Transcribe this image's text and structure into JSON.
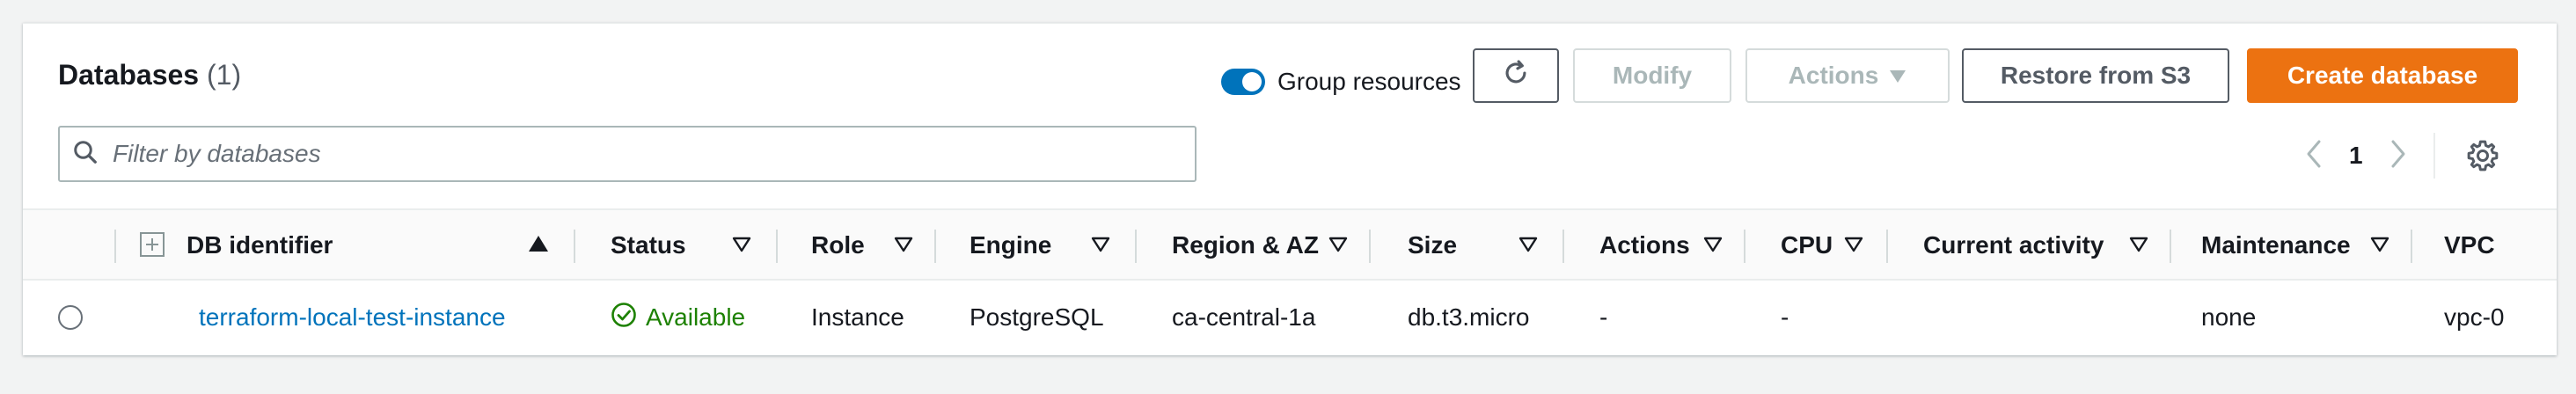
{
  "header": {
    "title": "Databases",
    "count": "(1)"
  },
  "toolbar": {
    "group_resources_label": "Group resources",
    "group_resources_on": true,
    "modify_label": "Modify",
    "actions_label": "Actions",
    "restore_label": "Restore from S3",
    "create_label": "Create database"
  },
  "search": {
    "placeholder": "Filter by databases"
  },
  "pagination": {
    "current_page": "1"
  },
  "table": {
    "columns": [
      "DB identifier",
      "Status",
      "Role",
      "Engine",
      "Region & AZ",
      "Size",
      "Actions",
      "CPU",
      "Current activity",
      "Maintenance",
      "VPC"
    ],
    "rows": [
      {
        "db_identifier": "terraform-local-test-instance",
        "status": "Available",
        "role": "Instance",
        "engine": "PostgreSQL",
        "region_az": "ca-central-1a",
        "size": "db.t3.micro",
        "actions": "-",
        "cpu": "-",
        "current_activity": "",
        "maintenance": "none",
        "vpc": "vpc-0"
      }
    ]
  },
  "colors": {
    "primary": "#ec7211",
    "link": "#0073bb",
    "success": "#1d8102",
    "toggle_on": "#0073bb"
  }
}
